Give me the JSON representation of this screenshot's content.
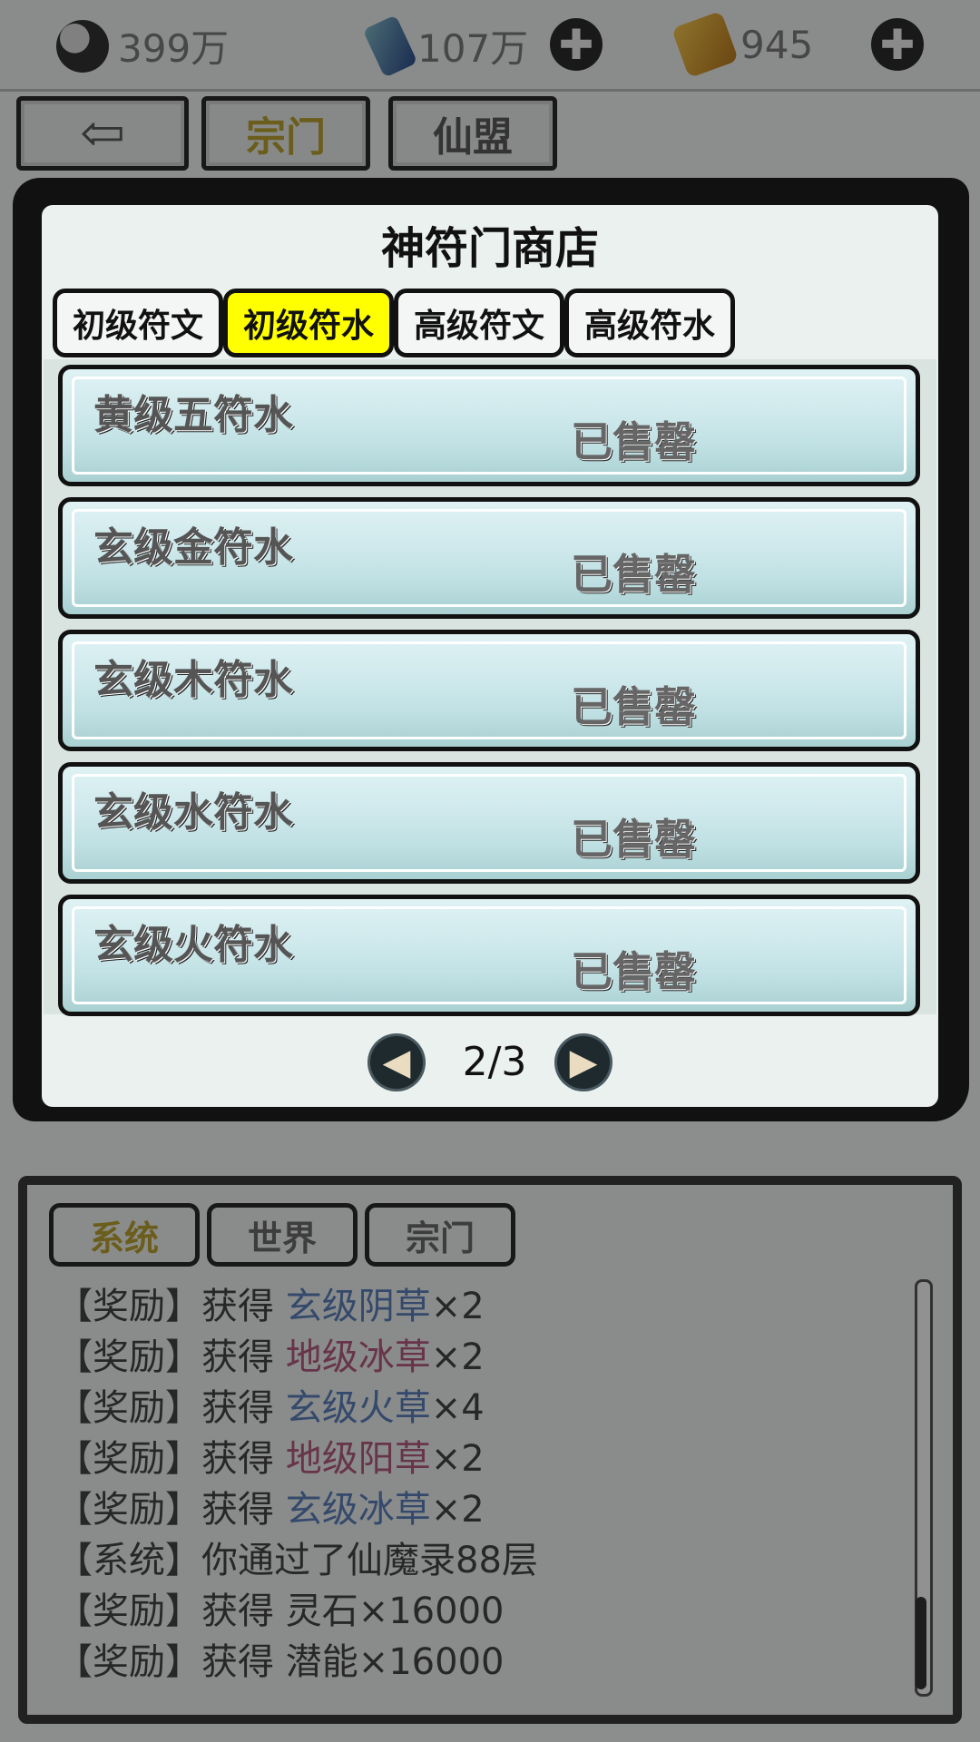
{
  "topbar": {
    "currencies": [
      {
        "icon": "yinyang-icon",
        "value": "399万"
      },
      {
        "icon": "jade-icon",
        "value": "107万"
      },
      {
        "icon": "gold-ingot-icon",
        "value": "945"
      }
    ],
    "plus_symbol": "✚"
  },
  "nav": {
    "back_symbol": "⇦",
    "tabs": [
      "宗门",
      "仙盟"
    ]
  },
  "shop": {
    "title": "神符门商店",
    "tabs": [
      {
        "label": "初级符文",
        "active": false
      },
      {
        "label": "初级符水",
        "active": true
      },
      {
        "label": "高级符文",
        "active": false
      },
      {
        "label": "高级符水",
        "active": false
      }
    ],
    "items": [
      {
        "name": "黄级五符水",
        "status": "已售罄"
      },
      {
        "name": "玄级金符水",
        "status": "已售罄"
      },
      {
        "name": "玄级木符水",
        "status": "已售罄"
      },
      {
        "name": "玄级水符水",
        "status": "已售罄"
      },
      {
        "name": "玄级火符水",
        "status": "已售罄"
      }
    ],
    "pagination": {
      "prev": "◀",
      "next": "▶",
      "page": "2/3"
    }
  },
  "chat": {
    "tabs": [
      "系统",
      "世界",
      "宗门"
    ],
    "lines": [
      {
        "prefix": "【奖励】获得 ",
        "item": "玄级阴草",
        "item_color": "#5a7fb8",
        "suffix": "×2"
      },
      {
        "prefix": "【奖励】获得 ",
        "item": "地级冰草",
        "item_color": "#b25a7e",
        "suffix": "×2"
      },
      {
        "prefix": "【奖励】获得 ",
        "item": "玄级火草",
        "item_color": "#5a7fb8",
        "suffix": "×4"
      },
      {
        "prefix": "【奖励】获得 ",
        "item": "地级阳草",
        "item_color": "#b25a7e",
        "suffix": "×2"
      },
      {
        "prefix": "【奖励】获得 ",
        "item": "玄级冰草",
        "item_color": "#5a7fb8",
        "suffix": "×2"
      },
      {
        "prefix": "【系统】你通过了仙魔录88层",
        "item": "",
        "item_color": "#444444",
        "suffix": ""
      },
      {
        "prefix": "【奖励】获得 灵石×16000",
        "item": "",
        "item_color": "#444444",
        "suffix": ""
      },
      {
        "prefix": "【奖励】获得 潜能×16000",
        "item": "",
        "item_color": "#444444",
        "suffix": ""
      }
    ]
  }
}
